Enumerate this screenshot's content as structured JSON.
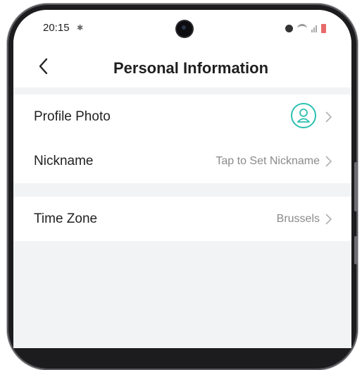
{
  "status_bar": {
    "time": "20:15",
    "gear_glyph": "✱"
  },
  "header": {
    "title": "Personal Information",
    "back_icon": "chevron-left-icon"
  },
  "profile_group": {
    "items": [
      {
        "label": "Profile Photo",
        "value": ""
      },
      {
        "label": "Nickname",
        "value": "Tap to Set Nickname"
      }
    ]
  },
  "settings_group": {
    "items": [
      {
        "label": "Time Zone",
        "value": "Brussels"
      }
    ]
  },
  "colors": {
    "accent": "#2cc0b0",
    "background": "#f2f3f5"
  }
}
